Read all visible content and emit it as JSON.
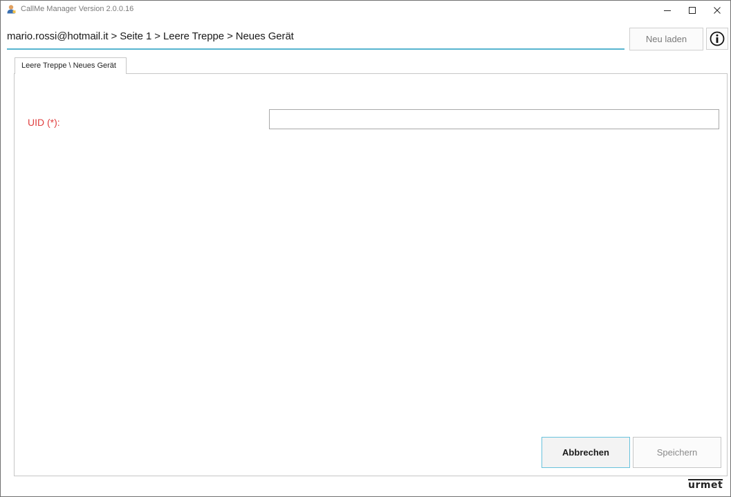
{
  "window": {
    "title": "CallMe Manager Version 2.0.0.16",
    "controls": {
      "minimize_icon": "minimize-icon",
      "maximize_icon": "maximize-icon",
      "close_icon": "close-icon"
    }
  },
  "header": {
    "breadcrumb": "mario.rossi@hotmail.it > Seite 1 > Leere Treppe > Neues Gerät",
    "reload_label": "Neu laden",
    "info_icon": "info-icon"
  },
  "tabs": [
    {
      "label": "Leere Treppe \\ Neues Gerät",
      "active": true
    }
  ],
  "form": {
    "uid_label": "UID (*):",
    "uid_value": "",
    "uid_placeholder": ""
  },
  "actions": {
    "cancel_label": "Abbrechen",
    "save_label": "Speichern"
  },
  "footer": {
    "brand": "urmet"
  },
  "colors": {
    "accent": "#56b4cf",
    "required_label": "#e04040",
    "focus_border": "#68c2dc"
  }
}
